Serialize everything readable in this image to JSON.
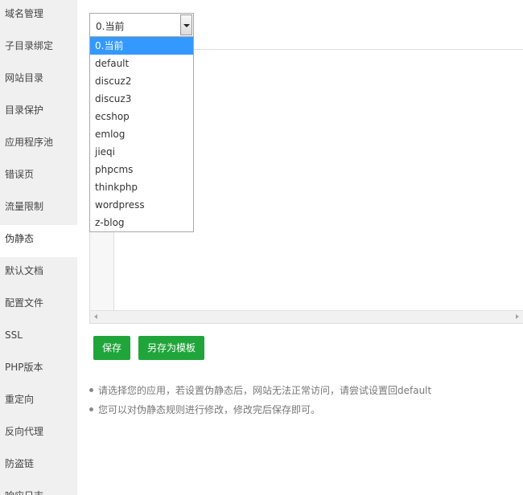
{
  "sidebar": {
    "items": [
      {
        "label": "域名管理"
      },
      {
        "label": "子目录绑定"
      },
      {
        "label": "网站目录"
      },
      {
        "label": "目录保护"
      },
      {
        "label": "应用程序池"
      },
      {
        "label": "错误页"
      },
      {
        "label": "流量限制"
      },
      {
        "label": "伪静态",
        "active": true
      },
      {
        "label": "默认文档"
      },
      {
        "label": "配置文件"
      },
      {
        "label": "SSL"
      },
      {
        "label": "PHP版本"
      },
      {
        "label": "重定向"
      },
      {
        "label": "反向代理"
      },
      {
        "label": "防盗链"
      },
      {
        "label": "响应日志"
      }
    ]
  },
  "rewrite": {
    "select": {
      "value": "0.当前",
      "options": [
        "0.当前",
        "default",
        "discuz2",
        "discuz3",
        "ecshop",
        "emlog",
        "jieqi",
        "phpcms",
        "thinkphp",
        "wordpress",
        "z-blog"
      ],
      "selected_index": 0
    },
    "buttons": {
      "save_label": "保存",
      "save_as_template_label": "另存为模板"
    },
    "notes": [
      "请选择您的应用，若设置伪静态后，网站无法正常访问，请尝试设置回default",
      "您可以对伪静态规则进行修改，修改完后保存即可。"
    ]
  },
  "colors": {
    "sidebar_bg": "#f0f0f0",
    "primary_button": "#20a53a",
    "selected_option": "#3399ff"
  }
}
